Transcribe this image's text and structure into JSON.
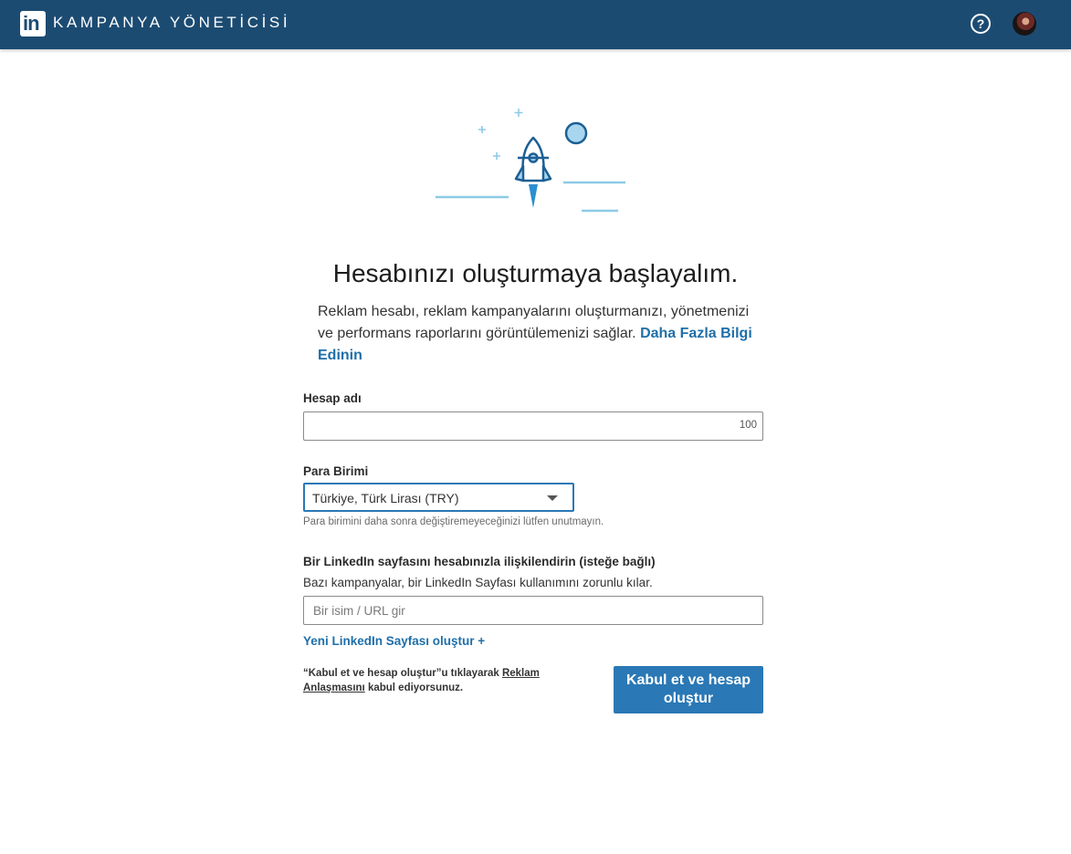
{
  "header": {
    "logo_text": "in",
    "app_title": "KAMPANYA YÖNETİCİSİ",
    "help_label": "?",
    "bg_color": "#1c4b72"
  },
  "main": {
    "headline": "Hesabınızı oluşturmaya başlayalım.",
    "intro_text": "Reklam hesabı, reklam kampanyalarını oluşturmanızı, yönetmenizi ve performans raporlarını görüntülemenizi sağlar.",
    "learn_more_link": "Daha Fazla Bilgi Edinin"
  },
  "form": {
    "account_name": {
      "label": "Hesap adı",
      "value": "",
      "counter": "100"
    },
    "currency": {
      "label": "Para Birimi",
      "selected": "Türkiye, Türk Lirası (TRY)",
      "hint": "Para birimini daha sonra değiştiremeyeceğinizi lütfen unutmayın."
    },
    "linkedin_page": {
      "label": "Bir LinkedIn sayfasını hesabınızla ilişkilendirin (isteğe bağlı)",
      "hint": "Bazı kampanyalar, bir LinkedIn Sayfası kullanımını zorunlu kılar.",
      "placeholder": "Bir isim / URL gir",
      "create_link": "Yeni LinkedIn Sayfası oluştur +"
    },
    "terms": {
      "prefix": "“Kabul et ve hesap oluştur”u tıklayarak ",
      "link": "Reklam Anlaşmasını",
      "suffix": " kabul ediyorsunuz."
    },
    "submit_label": "Kabul et ve hesap oluştur"
  },
  "colors": {
    "accent": "#2a78b5",
    "link": "#1f6fa9",
    "illustration_light": "#8ecae6",
    "illustration_dark": "#1c5f94"
  },
  "icons": {
    "help": "question-circle-icon",
    "illustration": "rocket-launch-icon"
  }
}
